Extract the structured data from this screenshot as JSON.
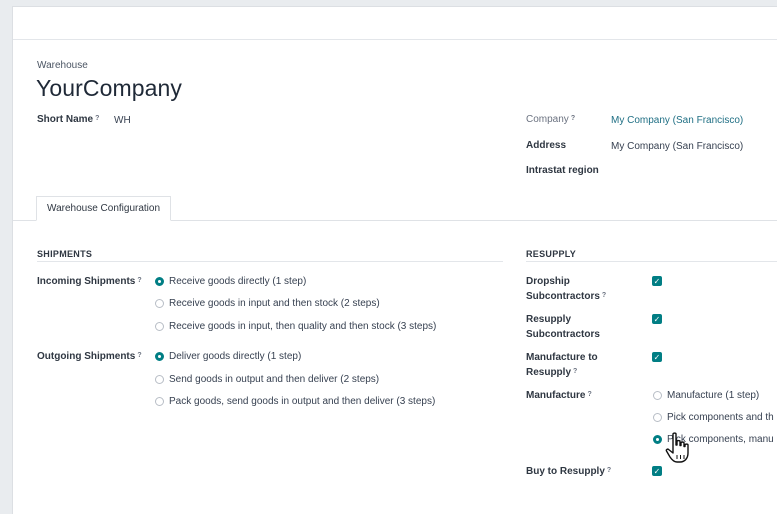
{
  "header": {
    "label": "Warehouse",
    "title": "YourCompany",
    "short_name_label": "Short Name",
    "short_name_value": "WH",
    "company_label": "Company",
    "company_value": "My Company (San Francisco)",
    "address_label": "Address",
    "address_value": "My Company (San Francisco)",
    "intrastat_label": "Intrastat region",
    "help_mark": "?"
  },
  "tabs": [
    {
      "label": "Warehouse Configuration",
      "active": true
    }
  ],
  "shipments": {
    "heading": "SHIPMENTS",
    "incoming": {
      "label": "Incoming Shipments",
      "options": [
        {
          "label": "Receive goods directly (1 step)",
          "selected": true
        },
        {
          "label": "Receive goods in input and then stock (2 steps)",
          "selected": false
        },
        {
          "label": "Receive goods in input, then quality and then stock (3 steps)",
          "selected": false
        }
      ]
    },
    "outgoing": {
      "label": "Outgoing Shipments",
      "options": [
        {
          "label": "Deliver goods directly (1 step)",
          "selected": true
        },
        {
          "label": "Send goods in output and then deliver (2 steps)",
          "selected": false
        },
        {
          "label": "Pack goods, send goods in output and then deliver (3 steps)",
          "selected": false
        }
      ]
    }
  },
  "resupply": {
    "heading": "RESUPPLY",
    "dropship_line1": "Dropship",
    "dropship_line2": "Subcontractors",
    "resupply_sub_line1": "Resupply",
    "resupply_sub_line2": "Subcontractors",
    "mto_line1": "Manufacture to",
    "mto_line2": "Resupply",
    "manufacture_label": "Manufacture",
    "manufacture_options": [
      {
        "label": "Manufacture (1 step)",
        "selected": false
      },
      {
        "label": "Pick components and th",
        "selected": false
      },
      {
        "label": "Pick components, manu",
        "selected": true
      }
    ],
    "buy_label": "Buy to Resupply"
  },
  "checkmark": "✓",
  "colors": {
    "accent": "#017e84",
    "link": "#1f6f84"
  },
  "icons": {
    "cursor": "hand-pointer-icon"
  }
}
